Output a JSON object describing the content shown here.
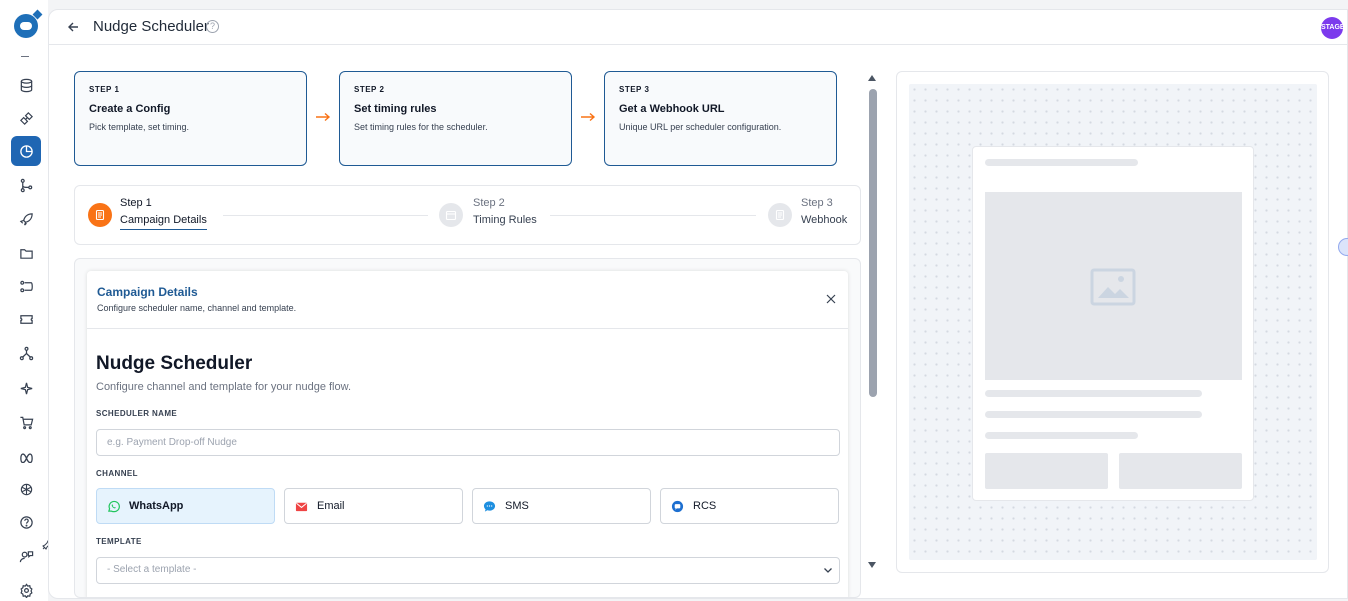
{
  "header": {
    "title": "Nudge Scheduler",
    "help_glyph": "?",
    "avatar_text": "STAGE"
  },
  "steps_cards": [
    {
      "kicker": "STEP 1",
      "title": "Create a Config",
      "desc": "Pick template, set timing."
    },
    {
      "kicker": "STEP 2",
      "title": "Set timing rules",
      "desc": "Set timing rules for the scheduler."
    },
    {
      "kicker": "STEP 3",
      "title": "Get a Webhook URL",
      "desc": "Unique URL per scheduler configuration."
    }
  ],
  "stepper": [
    {
      "step": "Step 1",
      "label": "Campaign Details",
      "state": "active"
    },
    {
      "step": "Step 2",
      "label": "Timing Rules",
      "state": "inactive"
    },
    {
      "step": "Step 3",
      "label": "Webhook",
      "state": "inactive"
    }
  ],
  "panel": {
    "title": "Campaign Details",
    "subtitle": "Configure scheduler name, channel and template."
  },
  "form": {
    "title": "Nudge Scheduler",
    "subtitle": "Configure channel and template for your nudge flow.",
    "name_label": "SCHEDULER NAME",
    "name_placeholder": "e.g. Payment Drop-off Nudge",
    "name_value": "",
    "channel_label": "CHANNEL",
    "channels": [
      {
        "name": "WhatsApp",
        "icon": "whatsapp-icon",
        "selected": true
      },
      {
        "name": "Email",
        "icon": "email-icon",
        "selected": false
      },
      {
        "name": "SMS",
        "icon": "sms-icon",
        "selected": false
      },
      {
        "name": "RCS",
        "icon": "rcs-icon",
        "selected": false
      }
    ],
    "template_label": "TEMPLATE",
    "template_selected": "- Select a template -"
  },
  "colors": {
    "accent": "#1f5a94",
    "active_step": "#f97316",
    "sidebar_active": "#1f66b3",
    "whatsapp": "#22c55e",
    "email": "#ef4444",
    "sms_rcs": "#1d8fe0"
  },
  "sidebar_icons": [
    "database-icon",
    "integrations-icon",
    "analytics-icon",
    "flow-icon",
    "rocket-icon",
    "folder-icon",
    "workflow-icon",
    "ticket-icon",
    "network-icon",
    "sparkle-icon",
    "cart-icon",
    "meta-icon",
    "openai-icon",
    "help-icon",
    "support-icon",
    "settings-icon"
  ]
}
